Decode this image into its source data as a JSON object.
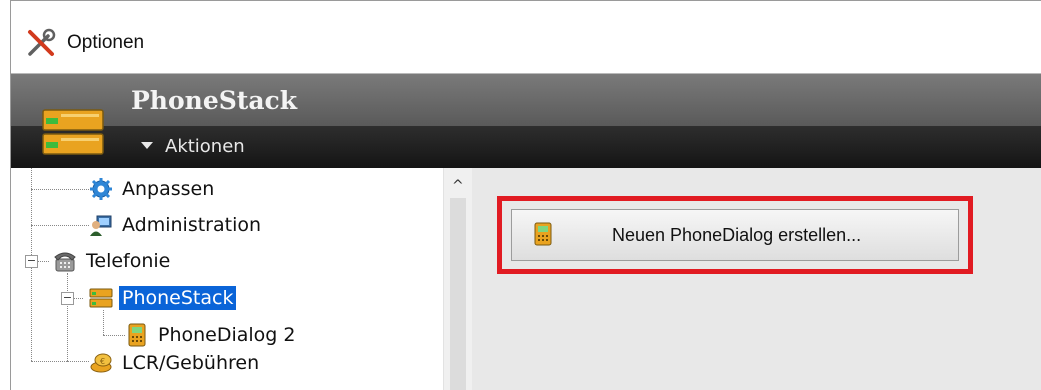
{
  "titlebar": {
    "title": "Optionen",
    "icon": "tools-icon"
  },
  "header": {
    "title": "PhoneStack",
    "actions_label": "Aktionen"
  },
  "tree": {
    "items": [
      {
        "label": "Anpassen",
        "icon": "gear-icon"
      },
      {
        "label": "Administration",
        "icon": "admin-users-icon"
      },
      {
        "label": "Telefonie",
        "icon": "phone-icon"
      },
      {
        "label": "PhoneStack",
        "icon": "server-icon",
        "selected": true
      },
      {
        "label": "PhoneDialog 2",
        "icon": "desk-phone-icon"
      },
      {
        "label": "LCR/Gebühren",
        "icon": "coins-icon"
      }
    ]
  },
  "actions": {
    "create_dialog_label": "Neuen PhoneDialog erstellen..."
  },
  "colors": {
    "highlight": "#e11b22",
    "selection": "#0a64d8"
  }
}
